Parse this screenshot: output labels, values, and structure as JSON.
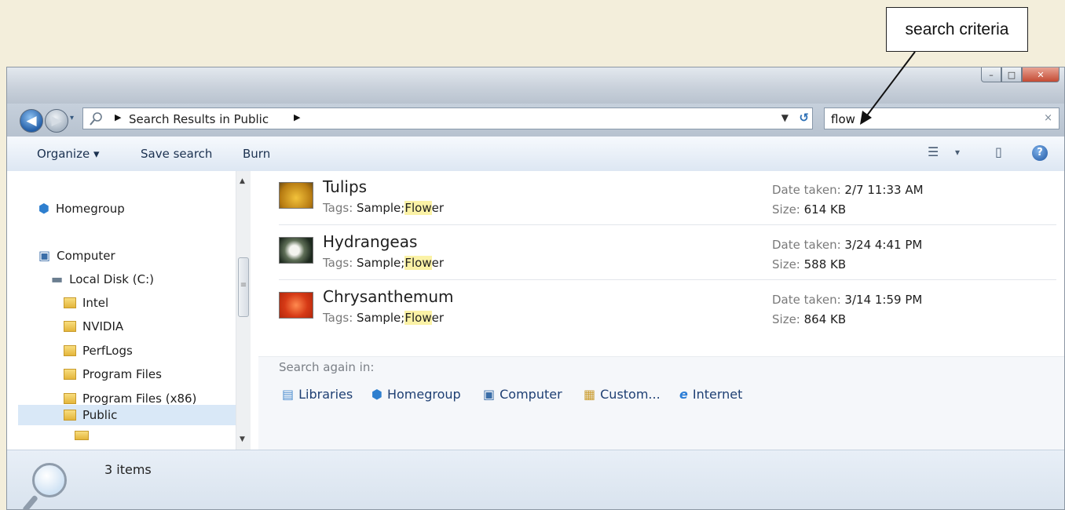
{
  "callout": {
    "label": "search criteria"
  },
  "window": {
    "controls": {
      "minimize": "–",
      "maximize": "□",
      "close": "✕"
    }
  },
  "navigation": {
    "back_label": "◀",
    "forward_label": "▶",
    "dropdown_glyph": "▾"
  },
  "address": {
    "path": "Search Results in Public",
    "arrow": "▶",
    "dropdown": "▼",
    "refresh": "↺"
  },
  "search": {
    "value": "flow",
    "clear": "×"
  },
  "toolbar": {
    "organize": "Organize ▾",
    "save_search": "Save search",
    "burn": "Burn",
    "view_glyph": "☰",
    "view_dd": "▾",
    "pane_glyph": "▯",
    "help_glyph": "?"
  },
  "nav_pane": {
    "items": [
      {
        "label": "Homegroup"
      },
      {
        "label": "Computer"
      },
      {
        "label": "Local Disk (C:)"
      },
      {
        "label": "Intel"
      },
      {
        "label": "NVIDIA"
      },
      {
        "label": "PerfLogs"
      },
      {
        "label": "Program Files"
      },
      {
        "label": "Program Files (x86)"
      },
      {
        "label": "Public"
      }
    ],
    "scroll_up": "▲",
    "scroll_down": "▼",
    "thumb_grip": "≡"
  },
  "results": [
    {
      "name": "Tulips",
      "tags_label": "Tags:",
      "tags_prefix": "Sample;",
      "tags_match": "Flow",
      "tags_rest": "er",
      "date_label": "Date taken:",
      "date_value": "2/7  11:33 AM",
      "size_label": "Size:",
      "size_value": "614 KB",
      "color": "#d9a324"
    },
    {
      "name": "Hydrangeas",
      "tags_label": "Tags:",
      "tags_prefix": "Sample;",
      "tags_match": "Flow",
      "tags_rest": "er",
      "date_label": "Date taken:",
      "date_value": "3/24  4:41 PM",
      "size_label": "Size:",
      "size_value": "588 KB",
      "color": "#3c4a3a"
    },
    {
      "name": "Chrysanthemum",
      "tags_label": "Tags:",
      "tags_prefix": "Sample;",
      "tags_match": "Flow",
      "tags_rest": "er",
      "date_label": "Date taken:",
      "date_value": "3/14  1:59 PM",
      "size_label": "Size:",
      "size_value": "864 KB",
      "color": "#d9441f"
    }
  ],
  "search_again": {
    "label": "Search again in:",
    "links": [
      {
        "label": "Libraries"
      },
      {
        "label": "Homegroup"
      },
      {
        "label": "Computer"
      },
      {
        "label": "Custom..."
      },
      {
        "label": "Internet"
      }
    ]
  },
  "status": {
    "count": "3 items"
  }
}
